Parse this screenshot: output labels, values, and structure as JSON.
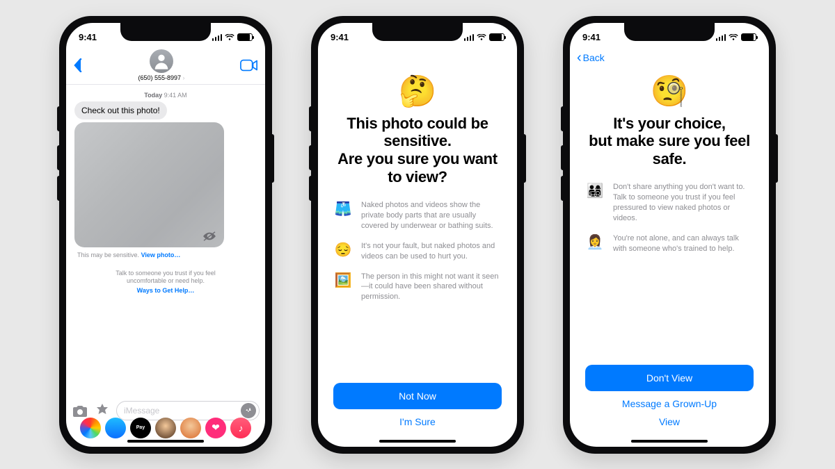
{
  "status": {
    "time": "9:41"
  },
  "phone1": {
    "contact_number": "(650) 555-8997",
    "timestamp_day": "Today",
    "timestamp_time": "9:41 AM",
    "bubble_text": "Check out this photo!",
    "caption_prefix": "This may be sensitive.",
    "caption_link": "View photo…",
    "guidance_text": "Talk to someone you trust if you feel uncomfortable or need help.",
    "guidance_link": "Ways to Get Help…",
    "composer_placeholder": "iMessage"
  },
  "phone2": {
    "emoji": "🤔",
    "headline_line1": "This photo could be sensitive.",
    "headline_line2": "Are you sure you want to view?",
    "bullets": [
      {
        "icon": "🩳",
        "text": "Naked photos and videos show the private body parts that are usually covered by underwear or bathing suits."
      },
      {
        "icon": "😔",
        "text": "It's not your fault, but naked photos and videos can be used to hurt you."
      },
      {
        "icon": "🖼️",
        "text": "The person in this might not want it seen—it could have been shared without permission."
      }
    ],
    "primary_label": "Not Now",
    "secondary_label": "I'm Sure"
  },
  "phone3": {
    "back_label": "Back",
    "emoji": "🧐",
    "headline_line1": "It's your choice,",
    "headline_line2": "but make sure you feel safe.",
    "bullets": [
      {
        "icon": "👨‍👩‍👧‍👦",
        "text": "Don't share anything you don't want to. Talk to someone you trust if you feel pressured to view naked photos or videos."
      },
      {
        "icon": "👩‍💼",
        "text": "You're not alone, and can always talk with someone who's trained to help."
      }
    ],
    "primary_label": "Don't View",
    "secondary_label": "Message a Grown-Up",
    "tertiary_label": "View"
  }
}
